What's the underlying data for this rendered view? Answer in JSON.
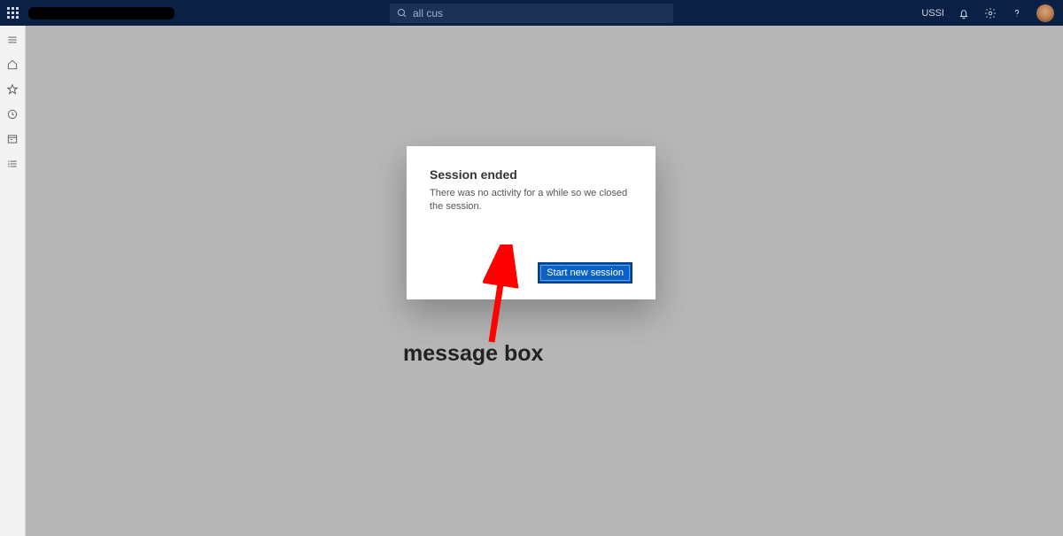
{
  "topbar": {
    "search_text": "all cus",
    "company": "USSI"
  },
  "dialog": {
    "title": "Session ended",
    "body": "There was no activity for a while so we closed the session.",
    "primary_button": "Start new session"
  },
  "annotation": {
    "label": "message box"
  }
}
